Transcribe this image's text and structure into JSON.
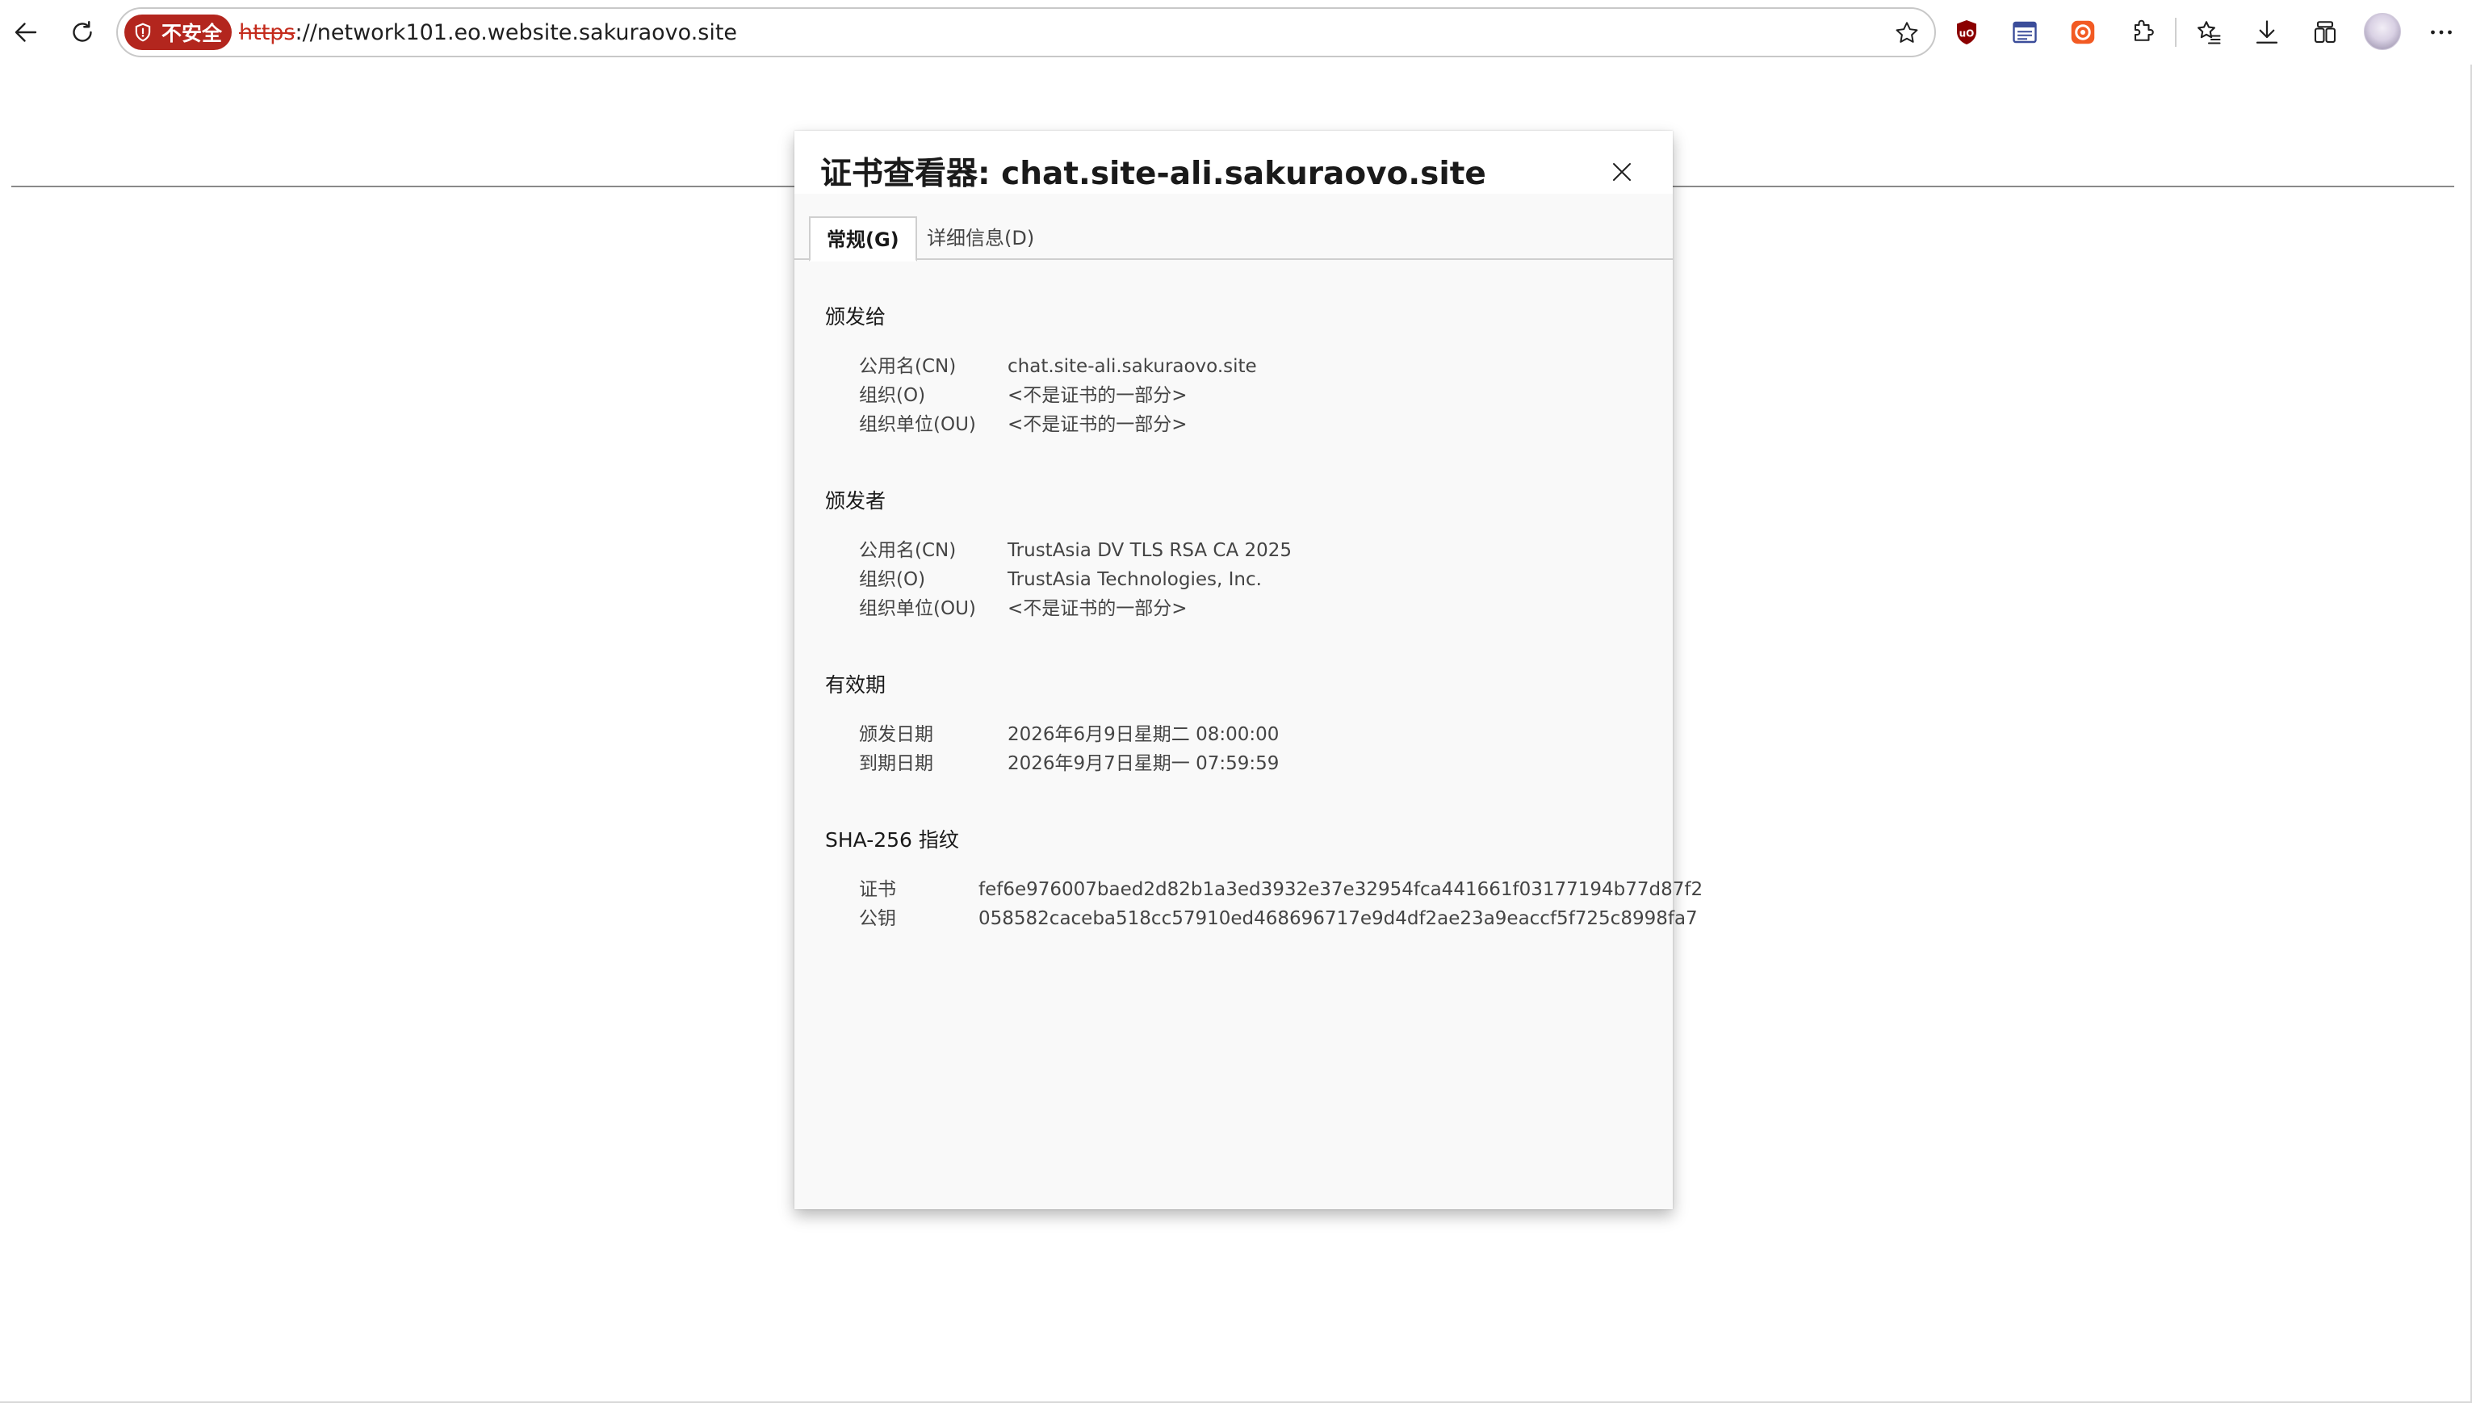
{
  "browser": {
    "security_label": "不安全",
    "url_scheme": "https",
    "url_rest": "://network101.eo.website.sakuraovo.site"
  },
  "dialog": {
    "title": "证书查看器: chat.site-ali.sakuraovo.site",
    "tabs": [
      {
        "label": "常规(G)",
        "active": true
      },
      {
        "label": "详细信息(D)",
        "active": false
      }
    ],
    "issued_to": {
      "title": "颁发给",
      "fields": [
        {
          "label": "公用名(CN)",
          "value": "chat.site-ali.sakuraovo.site"
        },
        {
          "label": "组织(O)",
          "value": "<不是证书的一部分>"
        },
        {
          "label": "组织单位(OU)",
          "value": "<不是证书的一部分>"
        }
      ]
    },
    "issued_by": {
      "title": "颁发者",
      "fields": [
        {
          "label": "公用名(CN)",
          "value": "TrustAsia DV TLS RSA CA 2025"
        },
        {
          "label": "组织(O)",
          "value": "TrustAsia Technologies, Inc."
        },
        {
          "label": "组织单位(OU)",
          "value": "<不是证书的一部分>"
        }
      ]
    },
    "validity": {
      "title": "有效期",
      "fields": [
        {
          "label": "颁发日期",
          "value": "2026年6月9日星期二 08:00:00"
        },
        {
          "label": "到期日期",
          "value": "2026年9月7日星期一 07:59:59"
        }
      ]
    },
    "fingerprints": {
      "title": "SHA-256 指纹",
      "fields": [
        {
          "label": "证书",
          "value": "fef6e976007baed2d82b1a3ed3932e37e32954fca441661f03177194b77d87f2"
        },
        {
          "label": "公钥",
          "value": "058582caceba518cc57910ed468696717e9d4df2ae23a9eaccf5f725c8998fa7"
        }
      ]
    }
  },
  "icons": {
    "back": "arrow-left-icon",
    "reload": "reload-icon",
    "security": "shield-warning-icon",
    "favorite": "star-icon",
    "ublock": "ublock-origin-icon",
    "reader": "reader-view-icon",
    "extension_orange": "extension-c-icon",
    "extensions": "puzzle-piece-icon",
    "favorites": "favorites-list-icon",
    "downloads": "download-icon",
    "collections": "collections-icon",
    "profile": "profile-avatar-icon",
    "more": "more-dots-icon",
    "close": "close-icon"
  },
  "colors": {
    "security_chip": "#b3261e",
    "url_scheme": "#c42b1c",
    "ublock": "#8b0000",
    "extension_orange": "#f25a23",
    "reader": "#3b4d9a"
  }
}
